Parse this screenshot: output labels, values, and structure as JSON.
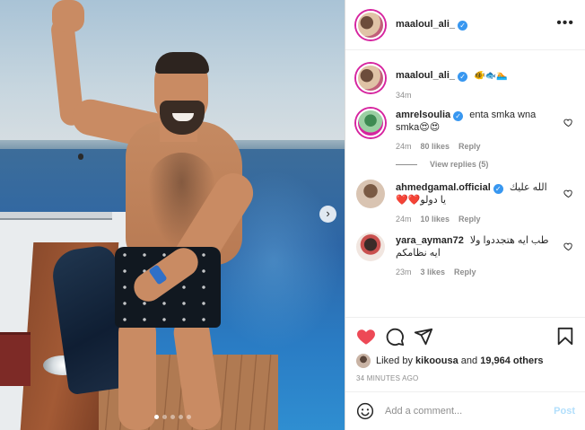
{
  "post": {
    "username": "maaloul_ali_",
    "caption_emoji": "🐠🐟🏊",
    "caption_time": "34m"
  },
  "comments": [
    {
      "username": "amrelsoulia",
      "text": "enta smka wna smka😍😍",
      "time": "24m",
      "likes": "80 likes",
      "reply": "Reply",
      "view_replies": "View replies (5)"
    },
    {
      "username": "ahmedgamal.official",
      "text": "الله عليك يا دولو❤️❤️",
      "time": "24m",
      "likes": "10 likes",
      "reply": "Reply"
    },
    {
      "username": "yara_ayman72",
      "text": "طب ايه هتجددوا ولا ايه نظامكم",
      "time": "23m",
      "likes": "3 likes",
      "reply": "Reply"
    }
  ],
  "likes": {
    "prefix": "Liked by",
    "user": "kikoousa",
    "middle": "and",
    "others": "19,964 others"
  },
  "timestamp": "34 MINUTES AGO",
  "add_comment": {
    "placeholder": "Add a comment...",
    "post_label": "Post"
  },
  "icons": {
    "like": "heart-filled-icon",
    "comment": "comment-icon",
    "share": "share-icon",
    "save": "bookmark-icon",
    "emoji": "emoji-icon",
    "more": "more-icon",
    "next": "chevron-right-icon"
  },
  "colors": {
    "like_red": "#ed4956",
    "verified_blue": "#3897f0",
    "post_button": "#b2dffc",
    "muted_text": "#8e8e8e"
  },
  "carousel": {
    "count": 5,
    "active": 1
  }
}
